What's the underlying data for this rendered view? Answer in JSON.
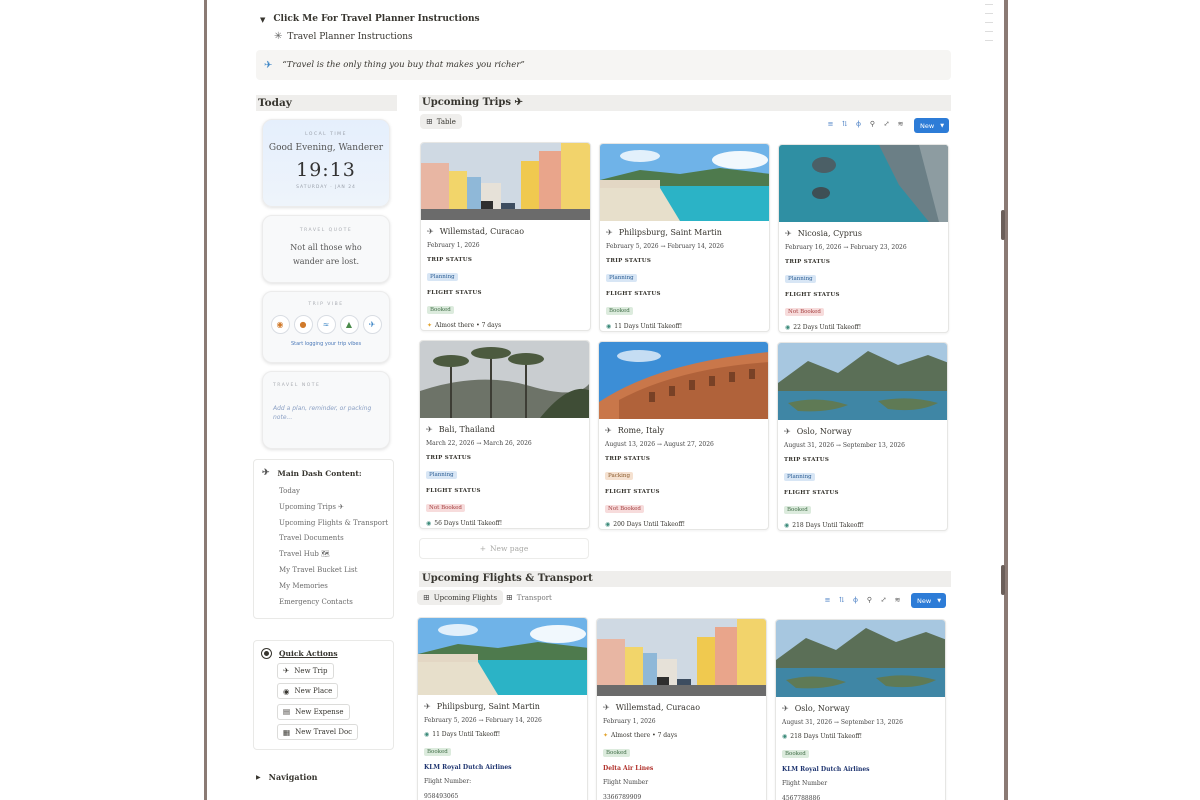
{
  "page": {
    "toggle_instructions": "Click Me For Travel Planner Instructions",
    "instructions_link": "Travel Planner Instructions",
    "quote": "“Travel is the only thing you buy that makes you richer”"
  },
  "today": {
    "heading": "Today",
    "time_widget": {
      "label": "LOCAL TIME",
      "greeting": "Good Evening, Wanderer",
      "clock": "19:13",
      "date": "SATURDAY · JAN 24"
    },
    "quote_widget": {
      "label": "TRAVEL QUOTE",
      "text": "Not all those who wander are lost."
    },
    "vibe_widget": {
      "label": "TRIP VIBE",
      "icons": [
        "compass-icon",
        "sun-icon",
        "wave-icon",
        "island-icon",
        "plane-icon"
      ],
      "cta": "Start logging your trip vibes"
    },
    "note_widget": {
      "label": "TRAVEL NOTE",
      "placeholder": "Add a plan, reminder, or packing note..."
    }
  },
  "main_dash": {
    "title": "Main Dash Content:",
    "items": [
      "Today",
      "Upcoming Trips ✈",
      "Upcoming Flights & Transport",
      "Travel Documents",
      "Travel Hub 🗺",
      "My Travel Bucket List",
      "My Memories",
      "Emergency Contacts"
    ]
  },
  "quick_actions": {
    "title": "Quick Actions",
    "buttons": [
      "New Trip",
      "New Place",
      "New Expense",
      "New Travel Doc"
    ]
  },
  "navigation": {
    "label": "Navigation"
  },
  "trips": {
    "heading": "Upcoming Trips ✈",
    "view_tab": "Table",
    "new_label": "New",
    "new_page": "New page",
    "trip_status_label": "TRIP STATUS",
    "flight_status_label": "FLIGHT STATUS",
    "cards": [
      {
        "title": "Willemstad, Curacao",
        "date": "February 1, 2026",
        "trip_status": "Planning",
        "flight_status": "Booked",
        "countdown": "Almost there • 7 days",
        "scene": "curacao"
      },
      {
        "title": "Philipsburg, Saint Martin",
        "date": "February 5, 2026 → February 14, 2026",
        "trip_status": "Planning",
        "flight_status": "Booked",
        "countdown": "11 Days Until Takeoff!",
        "scene": "beach"
      },
      {
        "title": "Nicosia, Cyprus",
        "date": "February 16, 2026 → February 23, 2026",
        "trip_status": "Planning",
        "flight_status": "Not Booked",
        "countdown": "22 Days Until Takeoff!",
        "scene": "cyprus"
      },
      {
        "title": "Bali, Thailand",
        "date": "March 22, 2026 → March 26, 2026",
        "trip_status": "Planning",
        "flight_status": "Not Booked",
        "countdown": "56 Days Until Takeoff!",
        "scene": "bali"
      },
      {
        "title": "Rome, Italy",
        "date": "August 13, 2026 → August 27, 2026",
        "trip_status": "Packing",
        "flight_status": "Not Booked",
        "countdown": "200 Days Until Takeoff!",
        "scene": "rome"
      },
      {
        "title": "Oslo, Norway",
        "date": "August 31, 2026 → September 13, 2026",
        "trip_status": "Planning",
        "flight_status": "Booked",
        "countdown": "218 Days Until Takeoff!",
        "scene": "oslo"
      }
    ]
  },
  "flights": {
    "heading": "Upcoming Flights & Transport",
    "tabs": [
      "Upcoming Flights",
      "Transport"
    ],
    "new_label": "New",
    "flight_number_label": "Flight Number:",
    "cards": [
      {
        "title": "Philipsburg, Saint Martin",
        "date": "February 5, 2026 → February 14, 2026",
        "countdown": "11 Days Until Takeoff!",
        "status": "Booked",
        "airline": "KLM Royal Dutch Airlines",
        "flight_number_label": "Flight Number:",
        "flight_number": "958493065",
        "scene": "beach"
      },
      {
        "title": "Willemstad, Curacao",
        "date": "February 1, 2026",
        "countdown": "Almost there • 7 days",
        "status": "Booked",
        "airline": "Delta Air Lines",
        "flight_number_label": "Flight Number",
        "flight_number": "3366789909",
        "scene": "curacao"
      },
      {
        "title": "Oslo, Norway",
        "date": "August 31, 2026 → September 13, 2026",
        "countdown": "218 Days Until Takeoff!",
        "status": "Booked",
        "airline": "KLM Royal Dutch Airlines",
        "flight_number_label": "Flight Number",
        "flight_number": "4567788886",
        "scene": "oslo"
      }
    ]
  },
  "colors": {
    "accent": "#2d7cd7",
    "tag_planning": "#d8e6f5",
    "tag_booked": "#dcebdd",
    "tag_not_booked": "#f7dcdc",
    "tag_packing": "#f5e1d0"
  }
}
